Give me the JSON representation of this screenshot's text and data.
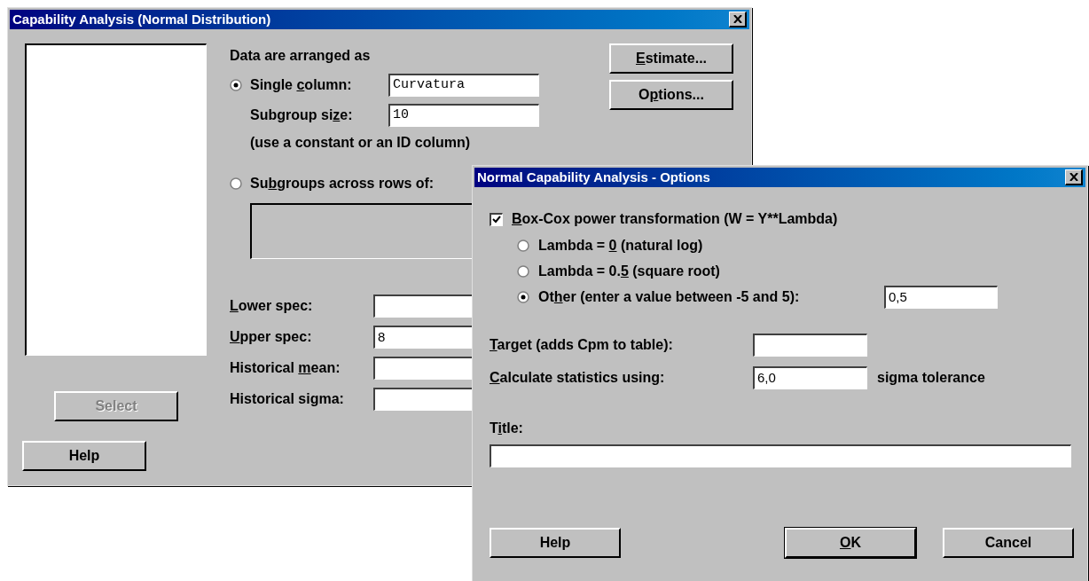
{
  "main_dialog": {
    "title": "Capability Analysis (Normal Distribution)",
    "arrangement_label": "Data are arranged as",
    "single_column": {
      "label": {
        "pre": "Single ",
        "key": "c",
        "post": "olumn:"
      },
      "selected": true,
      "value": "Curvatura"
    },
    "subgroup_size": {
      "label": {
        "pre": "Subgroup si",
        "key": "z",
        "post": "e:"
      },
      "value": "10"
    },
    "hint": "(use a constant or an ID column)",
    "subgroups_across": {
      "label": {
        "pre": "Su",
        "key": "b",
        "post": "groups across rows of:"
      },
      "selected": false
    },
    "spec_fields": [
      {
        "label": {
          "key": "L",
          "post": "ower spec:"
        }
      },
      {
        "label": {
          "key": "U",
          "post": "pper spec:"
        },
        "value": "8"
      },
      {
        "label": {
          "pre": "Historical ",
          "key": "m",
          "post": "ean:"
        }
      },
      {
        "label": {
          "pre": "Historical sigma:"
        }
      }
    ],
    "estimate_button": {
      "key": "E",
      "post": "stimate..."
    },
    "options_button": {
      "pre": "O",
      "key": "p",
      "post": "tions..."
    },
    "select_button": {
      "label": "Select",
      "disabled": true
    },
    "help_button": "Help"
  },
  "options_dialog": {
    "title": "Normal Capability Analysis - Options",
    "box_cox": {
      "label": {
        "key": "B",
        "post": "ox-Cox power transformation (W = Y**Lambda)"
      },
      "checked": true
    },
    "lambda_options": [
      {
        "label": {
          "pre": "Lambda = ",
          "key": "0",
          "post": " (natural log)"
        },
        "selected": false
      },
      {
        "label": {
          "pre": "Lambda = 0.",
          "key": "5",
          "post": " (square root)"
        },
        "selected": false
      },
      {
        "label": {
          "pre": "Ot",
          "key": "h",
          "post": "er (enter a value between -5 and 5):"
        },
        "selected": true,
        "value": "0,5"
      }
    ],
    "target": {
      "label": {
        "key": "T",
        "post": "arget (adds Cpm to table):"
      }
    },
    "calculate": {
      "label": {
        "key": "C",
        "post": "alculate statistics using:"
      },
      "value": "6,0",
      "suffix": "sigma tolerance"
    },
    "title_field": {
      "label": {
        "pre": "T",
        "key": "i",
        "post": "tle:"
      }
    },
    "buttons": [
      {
        "label": {
          "pre": "Help"
        },
        "kind": "left"
      },
      {
        "label": {
          "key": "O",
          "post": "K"
        },
        "kind": "default"
      },
      {
        "label": {
          "pre": "Cancel"
        },
        "kind": "right"
      }
    ]
  }
}
